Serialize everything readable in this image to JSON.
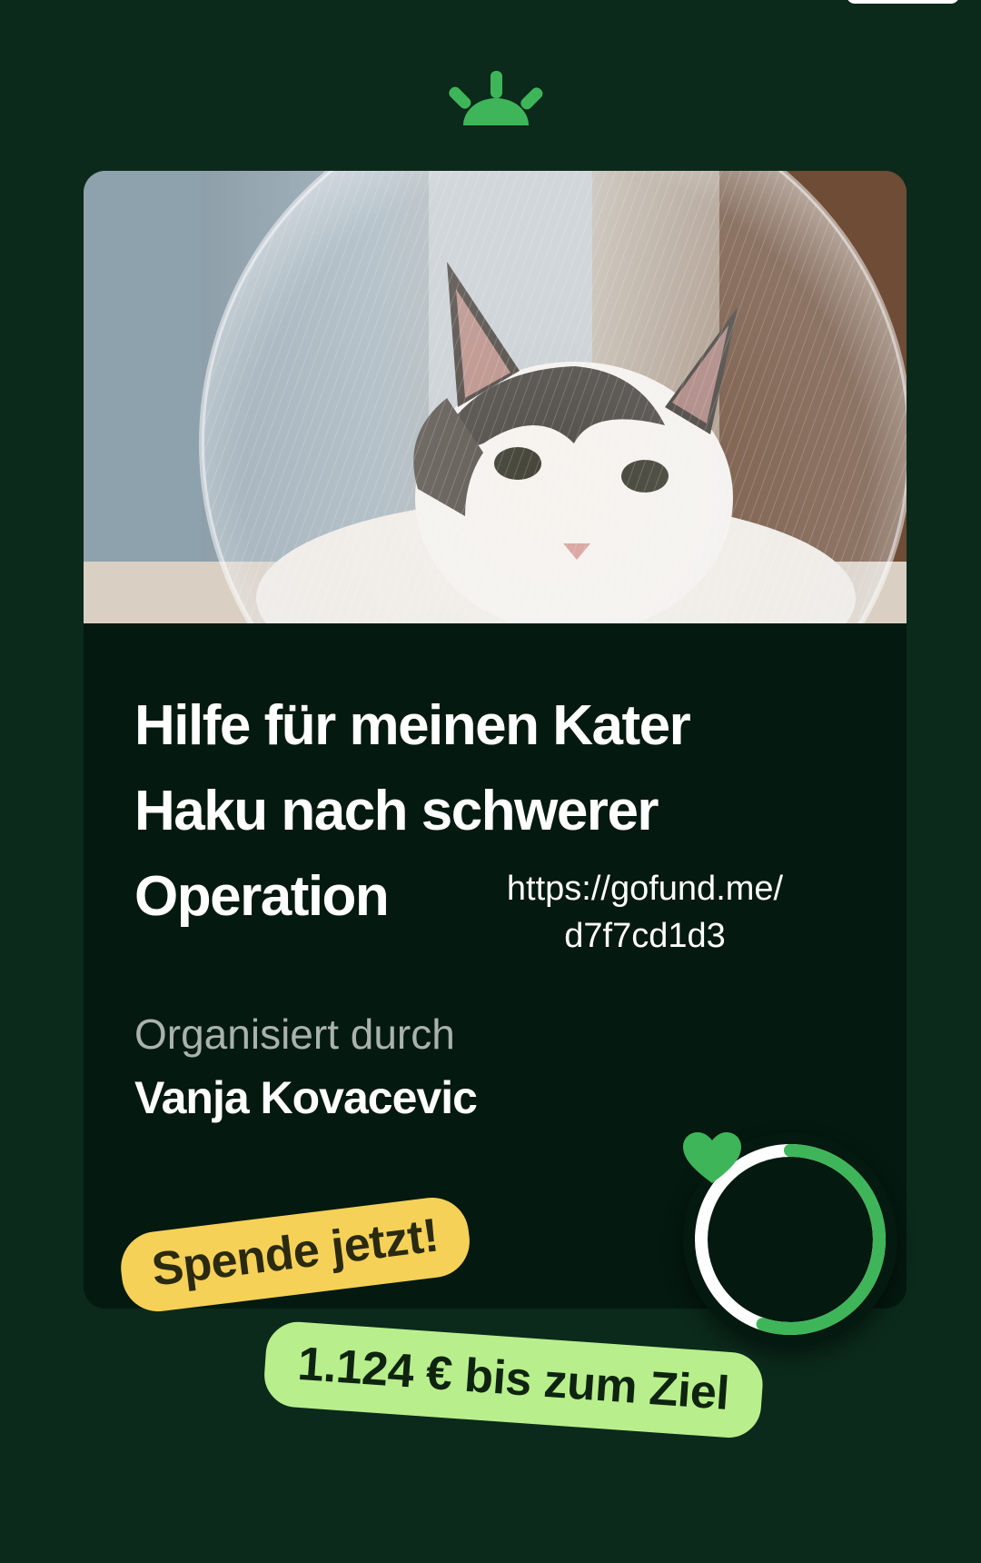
{
  "campaign": {
    "title": "Hilfe für meinen Kater Haku nach schwerer Operation",
    "url": "https://gofund.me/ d7f7cd1d3",
    "organizer_label": "Organisiert durch",
    "organizer_name": "Vanja Kovacevic"
  },
  "progress": {
    "fraction": 0.55
  },
  "badges": {
    "donate": "Spende jetzt!",
    "goal_remaining": "1.124 € bis zum Ziel"
  },
  "colors": {
    "background": "#0b2a1b",
    "card": "#04190f",
    "brand_green": "#3fb559",
    "ring_track": "#ffffff",
    "donate_badge": "#f6d158",
    "goal_badge": "#b8ef8c"
  },
  "icons": {
    "logo": "gofundme-sunrise-logo",
    "heart": "heart-icon",
    "photo": "cat-photo"
  }
}
